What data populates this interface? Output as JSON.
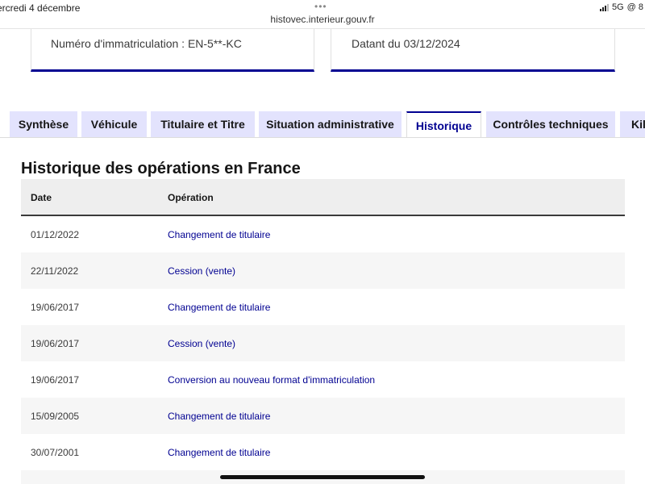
{
  "status_bar": {
    "date": "ercredi 4 décembre",
    "dots": "•••",
    "url": "histovec.interieur.gouv.fr",
    "network": "5G",
    "extra": "@ 8"
  },
  "cards": {
    "registration": "Numéro d'immatriculation : EN-5**-KC",
    "dated": "Datant du 03/12/2024"
  },
  "tabs": [
    {
      "label": "Synthèse",
      "active": false
    },
    {
      "label": "Véhicule",
      "active": false
    },
    {
      "label": "Titulaire et Titre",
      "active": false
    },
    {
      "label": "Situation administrative",
      "active": false
    },
    {
      "label": "Historique",
      "active": true
    },
    {
      "label": "Contrôles techniques",
      "active": false
    },
    {
      "label": "Kilo",
      "active": false
    }
  ],
  "section": {
    "title": "Historique des opérations en France"
  },
  "table": {
    "headers": {
      "date": "Date",
      "operation": "Opération"
    },
    "rows": [
      {
        "date": "01/12/2022",
        "operation": "Changement de titulaire"
      },
      {
        "date": "22/11/2022",
        "operation": "Cession (vente)"
      },
      {
        "date": "19/06/2017",
        "operation": "Changement de titulaire"
      },
      {
        "date": "19/06/2017",
        "operation": "Cession (vente)"
      },
      {
        "date": "19/06/2017",
        "operation": "Conversion au nouveau format d'immatriculation"
      },
      {
        "date": "15/09/2005",
        "operation": "Changement de titulaire"
      },
      {
        "date": "30/07/2001",
        "operation": "Changement de titulaire"
      }
    ]
  },
  "colors": {
    "accent": "#000091",
    "tab_background": "#e3e3fd",
    "row_alt": "#f6f6f6",
    "header_background": "#eeeeee"
  }
}
